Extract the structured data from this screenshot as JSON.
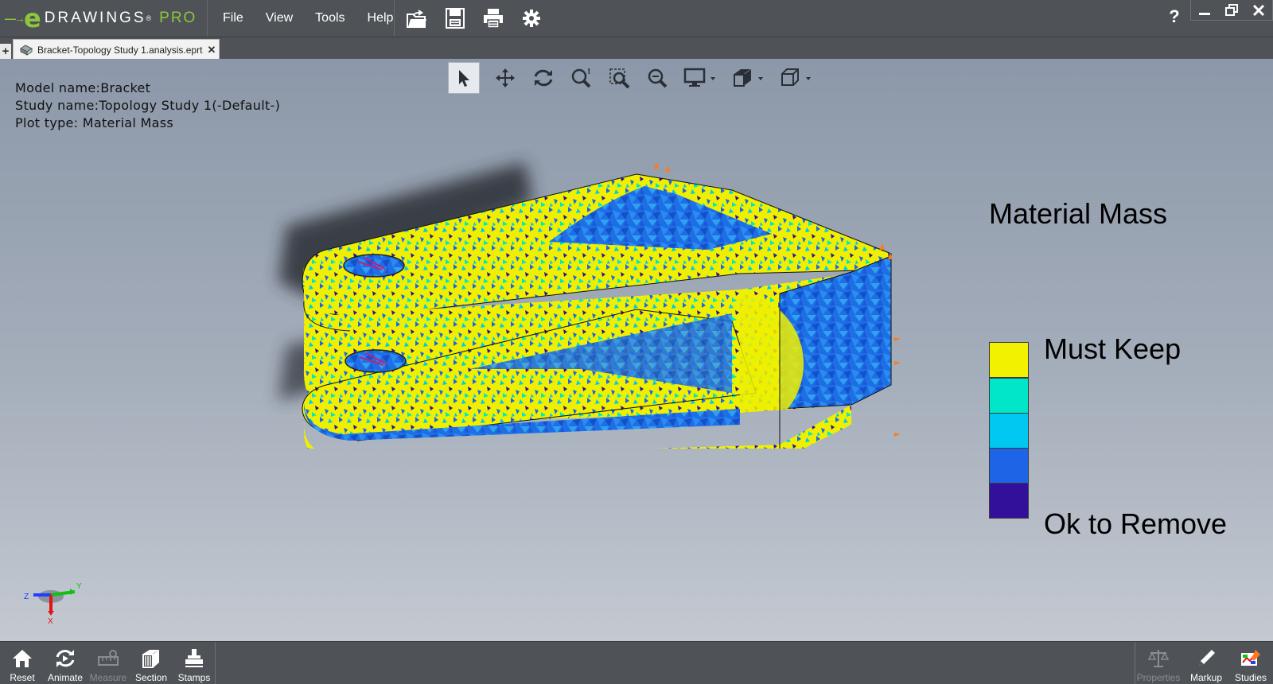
{
  "app": {
    "brand_letter": "e",
    "brand_word": "DRAWINGS",
    "brand_mark": "®",
    "brand_edition": "PRO",
    "menu": [
      "File",
      "View",
      "Tools",
      "Help"
    ],
    "quick_icons": [
      "open-icon",
      "save-icon",
      "print-icon",
      "settings-gear-icon"
    ],
    "help_label": "?",
    "window_controls": [
      "minimize",
      "restore",
      "close"
    ],
    "accent_color": "#8cc63f"
  },
  "tabs": {
    "new_tab_label": "+",
    "document_tab": "Bracket-Topology Study 1.analysis.eprt",
    "close_label": "✕"
  },
  "view_toolbar": {
    "items": [
      "select-icon",
      "pan-icon",
      "rotate-icon",
      "zoom-fit-icon",
      "zoom-area-icon",
      "zoom-icon",
      "display-style-icon",
      "view-orientation-icon",
      "box-view-icon"
    ],
    "active": "select-icon"
  },
  "info": {
    "model_name": "Model name:Bracket",
    "study_name": "Study name:Topology Study 1(-Default-)",
    "plot_type": "Plot type: Material Mass"
  },
  "legend": {
    "title": "Material Mass",
    "top_label": "Must Keep",
    "bottom_label": "Ok to Remove",
    "colors": [
      "#f2f200",
      "#00e6c8",
      "#00c8f0",
      "#1e64e6",
      "#32109a"
    ]
  },
  "triad": {
    "x_label": "X",
    "y_label": "Y",
    "z_label": "Z"
  },
  "bottom_bar": {
    "left": [
      {
        "label": "Reset",
        "icon": "home-icon",
        "enabled": true
      },
      {
        "label": "Animate",
        "icon": "animate-icon",
        "enabled": true
      },
      {
        "label": "Measure",
        "icon": "measure-icon",
        "enabled": false
      },
      {
        "label": "Section",
        "icon": "section-icon",
        "enabled": true
      },
      {
        "label": "Stamps",
        "icon": "stamps-icon",
        "enabled": true
      }
    ],
    "right": [
      {
        "label": "Properties",
        "icon": "properties-scale-icon",
        "enabled": false
      },
      {
        "label": "Markup",
        "icon": "markup-pen-icon",
        "enabled": true
      },
      {
        "label": "Studies",
        "icon": "studies-icon",
        "enabled": true
      }
    ]
  }
}
